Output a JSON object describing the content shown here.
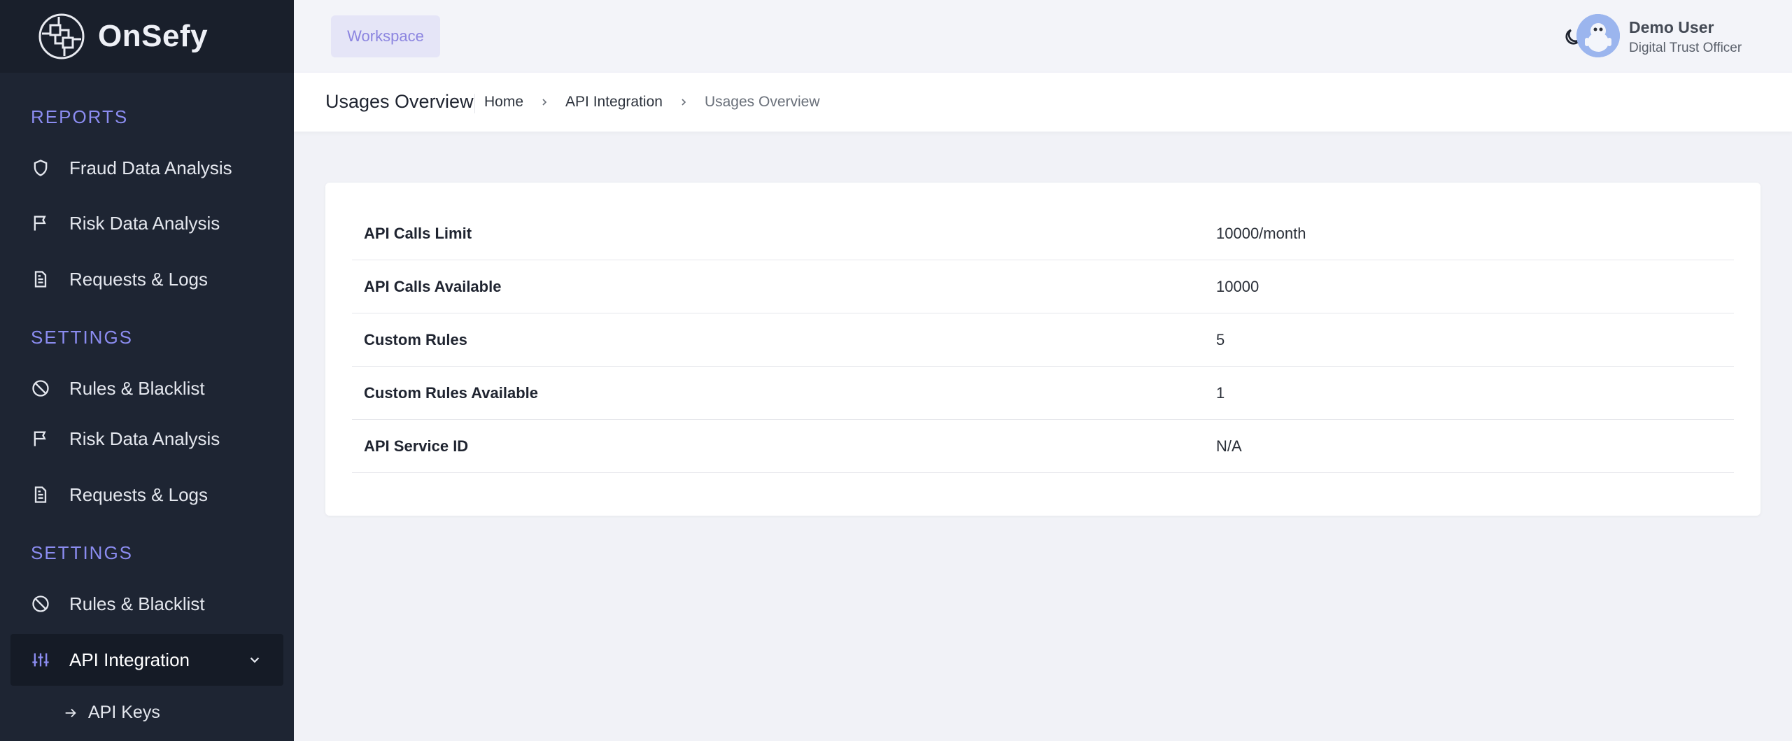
{
  "brand": {
    "name": "OnSefy"
  },
  "sidebar": {
    "sections": [
      {
        "title": "REPORTS"
      },
      {
        "title": "SETTINGS"
      },
      {
        "title": "SETTINGS"
      }
    ],
    "items": [
      {
        "label": "Fraud Data Analysis",
        "icon": "shield-icon"
      },
      {
        "label": "Risk Data Analysis",
        "icon": "flag-icon"
      },
      {
        "label": "Requests & Logs",
        "icon": "document-icon"
      },
      {
        "label": "Rules & Blacklist",
        "icon": "ban-icon"
      },
      {
        "label": "Risk Data Analysis",
        "icon": "flag-icon"
      },
      {
        "label": "Requests & Logs",
        "icon": "document-icon"
      },
      {
        "label": "Rules & Blacklist",
        "icon": "ban-icon"
      },
      {
        "label": "API Integration",
        "icon": "sliders-icon"
      }
    ],
    "sub_items": [
      {
        "label": "API Keys"
      }
    ]
  },
  "topbar": {
    "workspace_label": "Workspace",
    "user_name": "Demo User",
    "user_role": "Digital Trust Officer"
  },
  "breadcrumb": {
    "title": "Usages Overview",
    "items": [
      "Home",
      "API Integration",
      "Usages Overview"
    ]
  },
  "usage": {
    "rows": [
      {
        "label": "API Calls Limit",
        "value": "10000/month"
      },
      {
        "label": "API Calls Available",
        "value": "10000"
      },
      {
        "label": "Custom Rules",
        "value": "5"
      },
      {
        "label": "Custom Rules Available",
        "value": "1"
      },
      {
        "label": "API Service ID",
        "value": "N/A"
      }
    ]
  },
  "colors": {
    "sidebar_bg": "#1e2533",
    "accent": "#8b8cf0",
    "page_bg": "#f1f2f7"
  }
}
